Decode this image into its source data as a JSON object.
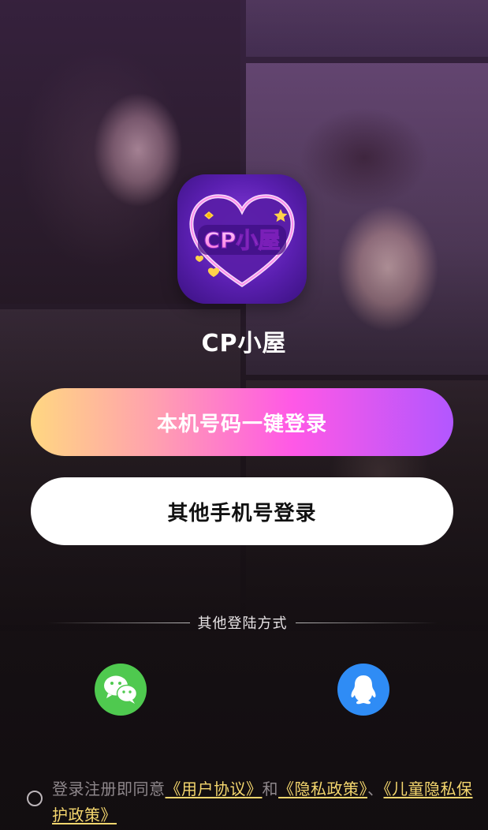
{
  "app": {
    "name": "CP小屋",
    "icon_text": "CP小屋"
  },
  "buttons": {
    "one_click_login": "本机号码一键登录",
    "other_phone_login": "其他手机号登录"
  },
  "other_login": {
    "divider_label": "其他登陆方式",
    "methods": [
      {
        "name": "wechat",
        "icon": "wechat-icon",
        "color": "#4fc94f"
      },
      {
        "name": "qq",
        "icon": "qq-icon",
        "color": "#2f8cf5"
      }
    ]
  },
  "agreement": {
    "prefix": "登录注册即同意",
    "user_agreement": "《用户协议》",
    "and": "和",
    "privacy_policy": "《隐私政策》",
    "separator": "、",
    "children_privacy": "《儿童隐私保护政策》",
    "checked": false
  },
  "colors": {
    "link": "#f4d66e",
    "gradient": [
      "#ffd781",
      "#ff9fb0",
      "#ff58e6",
      "#b257ff"
    ]
  }
}
